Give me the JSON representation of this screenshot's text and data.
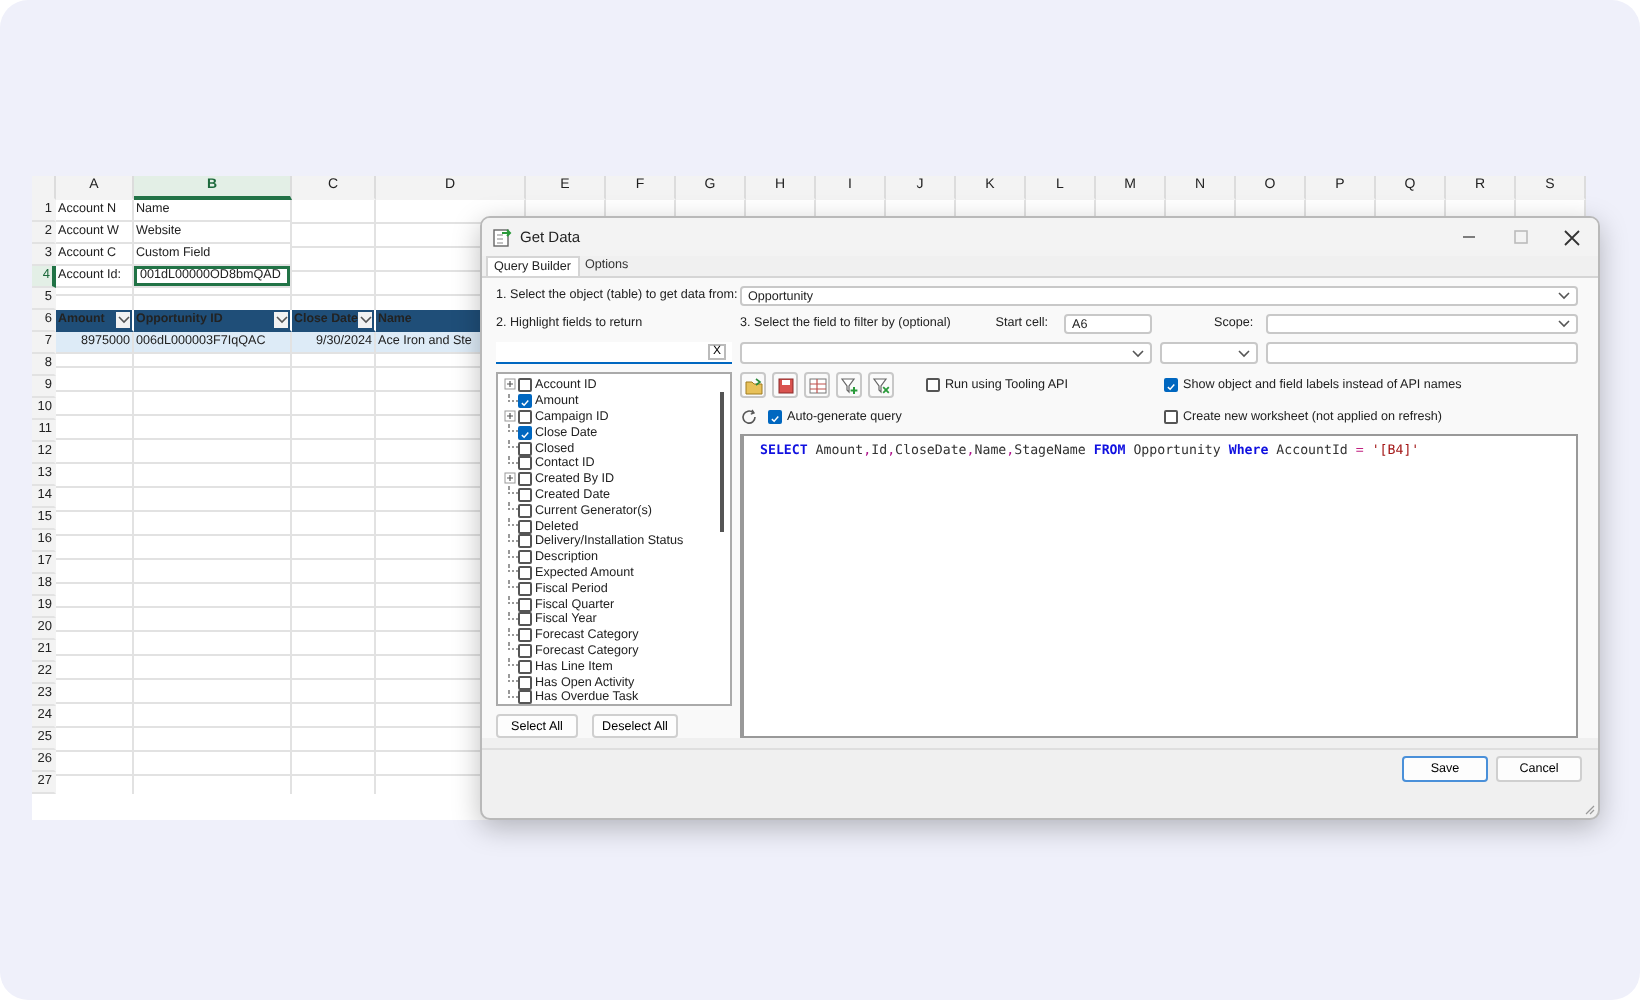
{
  "spreadsheet": {
    "columns": [
      {
        "label": "A",
        "selected": false
      },
      {
        "label": "B",
        "selected": true
      },
      {
        "label": "C",
        "selected": false
      },
      {
        "label": "D",
        "selected": false
      },
      {
        "label": "E",
        "selected": false
      },
      {
        "label": "F",
        "selected": false
      },
      {
        "label": "G",
        "selected": false
      },
      {
        "label": "H",
        "selected": false
      },
      {
        "label": "I",
        "selected": false
      },
      {
        "label": "J",
        "selected": false
      },
      {
        "label": "K",
        "selected": false
      },
      {
        "label": "L",
        "selected": false
      },
      {
        "label": "M",
        "selected": false
      },
      {
        "label": "N",
        "selected": false
      },
      {
        "label": "O",
        "selected": false
      },
      {
        "label": "P",
        "selected": false
      },
      {
        "label": "Q",
        "selected": false
      },
      {
        "label": "R",
        "selected": false
      },
      {
        "label": "S",
        "selected": false
      }
    ],
    "rows": [
      {
        "number": "1",
        "kind": "plain",
        "selected": false,
        "cells": [
          {
            "text": "Account N",
            "kind": "text",
            "selected": false
          },
          {
            "text": "Name",
            "kind": "text",
            "selected": false
          }
        ]
      },
      {
        "number": "2",
        "kind": "plain",
        "selected": false,
        "cells": [
          {
            "text": "Account W",
            "kind": "text",
            "selected": false
          },
          {
            "text": "Website",
            "kind": "text",
            "selected": false
          }
        ]
      },
      {
        "number": "3",
        "kind": "plain",
        "selected": false,
        "cells": [
          {
            "text": "Account C",
            "kind": "text",
            "selected": false
          },
          {
            "text": "Custom Field",
            "kind": "text",
            "selected": false
          }
        ]
      },
      {
        "number": "4",
        "kind": "plain",
        "selected": true,
        "cells": [
          {
            "text": "Account Id:",
            "kind": "text",
            "selected": false
          },
          {
            "text": "001dL00000OD8bmQAD",
            "kind": "text",
            "selected": true
          }
        ]
      },
      {
        "number": "5",
        "kind": "plain",
        "selected": false
      },
      {
        "number": "6",
        "kind": "table-header",
        "selected": false,
        "cells": [
          {
            "text": "Amount",
            "kind": "text",
            "selected": false
          },
          {
            "text": "Opportunity ID",
            "kind": "text",
            "selected": false
          },
          {
            "text": "Close Date",
            "kind": "text",
            "selected": false
          },
          {
            "text": "Name",
            "kind": "text",
            "selected": false
          }
        ]
      },
      {
        "number": "7",
        "kind": "table-row",
        "selected": false,
        "cells": [
          {
            "text": "8975000",
            "kind": "number",
            "selected": false
          },
          {
            "text": "006dL000003F7IqQAC",
            "kind": "text",
            "selected": false
          },
          {
            "text": "9/30/2024",
            "kind": "number",
            "selected": false
          },
          {
            "text": "Ace Iron and Ste",
            "kind": "text",
            "selected": false
          }
        ]
      },
      {
        "number": "8",
        "kind": "plain",
        "selected": false
      },
      {
        "number": "9",
        "kind": "plain",
        "selected": false
      },
      {
        "number": "10",
        "kind": "plain",
        "selected": false
      },
      {
        "number": "11",
        "kind": "plain",
        "selected": false
      },
      {
        "number": "12",
        "kind": "plain",
        "selected": false
      },
      {
        "number": "13",
        "kind": "plain",
        "selected": false
      },
      {
        "number": "14",
        "kind": "plain",
        "selected": false
      },
      {
        "number": "15",
        "kind": "plain",
        "selected": false
      },
      {
        "number": "16",
        "kind": "plain",
        "selected": false
      },
      {
        "number": "17",
        "kind": "plain",
        "selected": false
      },
      {
        "number": "18",
        "kind": "plain",
        "selected": false
      },
      {
        "number": "19",
        "kind": "plain",
        "selected": false
      },
      {
        "number": "20",
        "kind": "plain",
        "selected": false
      },
      {
        "number": "21",
        "kind": "plain",
        "selected": false
      },
      {
        "number": "22",
        "kind": "plain",
        "selected": false
      },
      {
        "number": "23",
        "kind": "plain",
        "selected": false
      },
      {
        "number": "24",
        "kind": "plain",
        "selected": false
      },
      {
        "number": "25",
        "kind": "plain",
        "selected": false
      },
      {
        "number": "26",
        "kind": "plain",
        "selected": false
      },
      {
        "number": "27",
        "kind": "plain",
        "selected": false
      }
    ]
  },
  "dialog": {
    "title": "Get Data",
    "tabs": [
      {
        "label": "Query Builder",
        "selected": true
      },
      {
        "label": "Options",
        "selected": false
      }
    ],
    "object_label": "1. Select the object (table) to get data from:",
    "object_value": "Opportunity",
    "fields_label": "2. Highlight fields to return",
    "fields_search_clear": "X",
    "fields": [
      {
        "label": "Account ID",
        "checked": false,
        "expandable": true
      },
      {
        "label": "Amount",
        "checked": true,
        "expandable": false
      },
      {
        "label": "Campaign ID",
        "checked": false,
        "expandable": true
      },
      {
        "label": "Close Date",
        "checked": true,
        "expandable": false
      },
      {
        "label": "Closed",
        "checked": false,
        "expandable": false
      },
      {
        "label": "Contact ID",
        "checked": false,
        "expandable": false
      },
      {
        "label": "Created By ID",
        "checked": false,
        "expandable": true
      },
      {
        "label": "Created Date",
        "checked": false,
        "expandable": false
      },
      {
        "label": "Current Generator(s)",
        "checked": false,
        "expandable": false
      },
      {
        "label": "Deleted",
        "checked": false,
        "expandable": false
      },
      {
        "label": "Delivery/Installation Status",
        "checked": false,
        "expandable": false
      },
      {
        "label": "Description",
        "checked": false,
        "expandable": false
      },
      {
        "label": "Expected Amount",
        "checked": false,
        "expandable": false
      },
      {
        "label": "Fiscal Period",
        "checked": false,
        "expandable": false
      },
      {
        "label": "Fiscal Quarter",
        "checked": false,
        "expandable": false
      },
      {
        "label": "Fiscal Year",
        "checked": false,
        "expandable": false
      },
      {
        "label": "Forecast Category",
        "checked": false,
        "expandable": false
      },
      {
        "label": "Forecast Category",
        "checked": false,
        "expandable": false
      },
      {
        "label": "Has Line Item",
        "checked": false,
        "expandable": false
      },
      {
        "label": "Has Open Activity",
        "checked": false,
        "expandable": false
      },
      {
        "label": "Has Overdue Task",
        "checked": false,
        "expandable": false
      }
    ],
    "select_all": "Select All",
    "deselect_all": "Deselect All",
    "filter_label": "3. Select the field to filter by (optional)",
    "start_cell_label": "Start cell:",
    "start_cell": "A6",
    "scope_label": "Scope:",
    "options": [
      {
        "label": "Run using Tooling API",
        "checked": false
      },
      {
        "label": "Show object and field labels instead of API names",
        "checked": true
      },
      {
        "label": "Auto-generate query",
        "checked": true
      },
      {
        "label": "Create new worksheet (not applied on refresh)",
        "checked": false
      }
    ],
    "query": [
      {
        "text": "SELECT",
        "kind": "keyword"
      },
      {
        "text": " Amount",
        "kind": "plain"
      },
      {
        "text": ",",
        "kind": "punct"
      },
      {
        "text": "Id",
        "kind": "plain"
      },
      {
        "text": ",",
        "kind": "punct"
      },
      {
        "text": "CloseDate",
        "kind": "plain"
      },
      {
        "text": ",",
        "kind": "punct"
      },
      {
        "text": "Name",
        "kind": "plain"
      },
      {
        "text": ",",
        "kind": "punct"
      },
      {
        "text": "StageName ",
        "kind": "plain"
      },
      {
        "text": "FROM",
        "kind": "keyword"
      },
      {
        "text": " Opportunity ",
        "kind": "plain"
      },
      {
        "text": "Where",
        "kind": "keyword"
      },
      {
        "text": " AccountId ",
        "kind": "plain"
      },
      {
        "text": "=",
        "kind": "operator"
      },
      {
        "text": " '[B4]'",
        "kind": "string"
      }
    ],
    "buttons": [
      {
        "label": "Save",
        "kind": "primary"
      },
      {
        "label": "Cancel",
        "kind": "normal"
      }
    ]
  }
}
